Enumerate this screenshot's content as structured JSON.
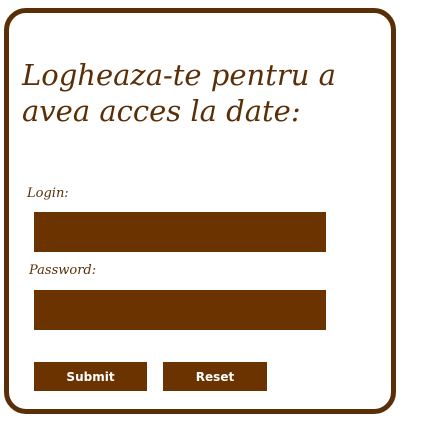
{
  "login_form": {
    "heading": "Logheaza-te pentru a avea acces la date:",
    "login_label": "Login:",
    "login_value": "",
    "password_label": "Password:",
    "password_value": "",
    "submit_label": "Submit",
    "reset_label": "Reset"
  },
  "colors": {
    "brand_brown": "#6b3300",
    "border_brown": "#5a2f08",
    "background": "#ffffff"
  }
}
